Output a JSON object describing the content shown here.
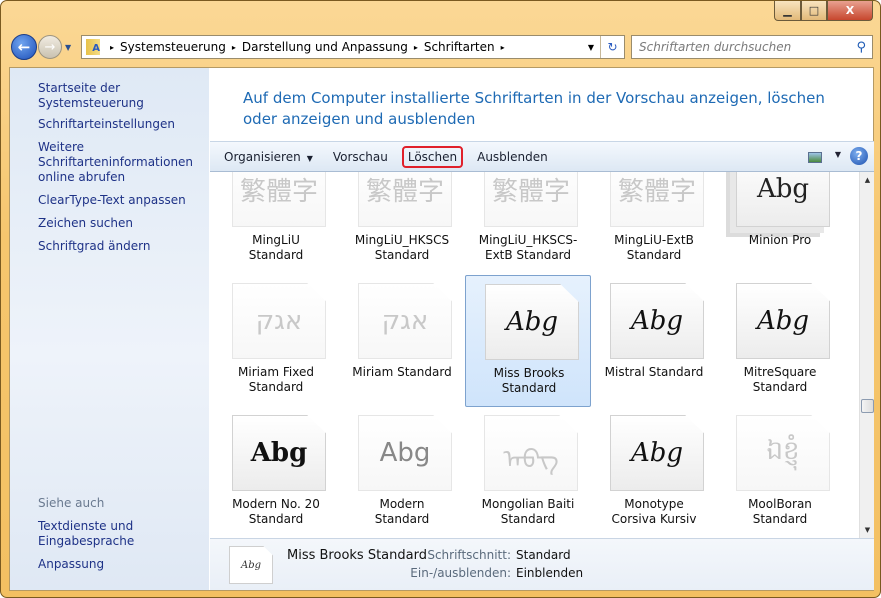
{
  "window": {
    "minimize": "▁",
    "maximize": "□",
    "close": "X"
  },
  "nav": {
    "back": "←",
    "forward": "→",
    "dropdown": "▼"
  },
  "address": {
    "crumbs": [
      "Systemsteuerung",
      "Darstellung und Anpassung",
      "Schriftarten"
    ],
    "separator": "▸",
    "dropdown": "▼",
    "refresh": "↻"
  },
  "search": {
    "placeholder": "Schriftarten durchsuchen",
    "icon": "⚲"
  },
  "sidebar": {
    "items": [
      "Startseite der Systemsteuerung",
      "Schriftarteinstellungen",
      "Weitere Schriftarteninformationen online abrufen",
      "ClearType-Text anpassen",
      "Zeichen suchen",
      "Schriftgrad ändern"
    ],
    "see_also": "Siehe auch",
    "see_items": [
      "Textdienste und Eingabesprache",
      "Anpassung"
    ]
  },
  "heading": "Auf dem Computer installierte Schriftarten in der Vorschau anzeigen, löschen oder anzeigen und ausblenden",
  "toolbar": {
    "organize": "Organisieren",
    "preview": "Vorschau",
    "delete": "Löschen",
    "hide": "Ausblenden",
    "caret": "▼",
    "help": "?"
  },
  "fonts": [
    {
      "name": "MingLiU Standard",
      "preview": "繁體字",
      "style": "faded"
    },
    {
      "name": "MingLiU_HKSCS Standard",
      "preview": "繁體字",
      "style": "faded"
    },
    {
      "name": "MingLiU_HKSCS-ExtB Standard",
      "preview": "繁體字",
      "style": "faded"
    },
    {
      "name": "MingLiU-ExtB Standard",
      "preview": "繁體字",
      "style": "faded"
    },
    {
      "name": "Minion Pro",
      "preview": "Abg",
      "style": "stack"
    },
    {
      "name": "Miriam Fixed Standard",
      "preview": "אגק",
      "style": "faded"
    },
    {
      "name": "Miriam Standard",
      "preview": "אגק",
      "style": "faded"
    },
    {
      "name": "Miss Brooks Standard",
      "preview": "Abg",
      "style": "script",
      "selected": true
    },
    {
      "name": "Mistral Standard",
      "preview": "Abg",
      "style": "script"
    },
    {
      "name": "MitreSquare Standard",
      "preview": "Abg",
      "style": "script"
    },
    {
      "name": "Modern No. 20 Standard",
      "preview": "Abg",
      "style": "serif"
    },
    {
      "name": "Modern Standard",
      "preview": "Abg",
      "style": "faded-dark"
    },
    {
      "name": "Mongolian Baiti Standard",
      "preview": "ᠠᠪᠭ",
      "style": "faded"
    },
    {
      "name": "Monotype Corsiva Kursiv",
      "preview": "Abg",
      "style": "script"
    },
    {
      "name": "MoolBoran Standard",
      "preview": "ឯខ្ញុំ",
      "style": "faded"
    }
  ],
  "scrollbar": {
    "up": "▲",
    "down": "▼"
  },
  "details": {
    "name": "Miss Brooks Standard",
    "preview": "Abg",
    "style_label": "Schriftschnitt:",
    "style_value": "Standard",
    "visibility_label": "Ein-/ausblenden:",
    "visibility_value": "Einblenden"
  }
}
